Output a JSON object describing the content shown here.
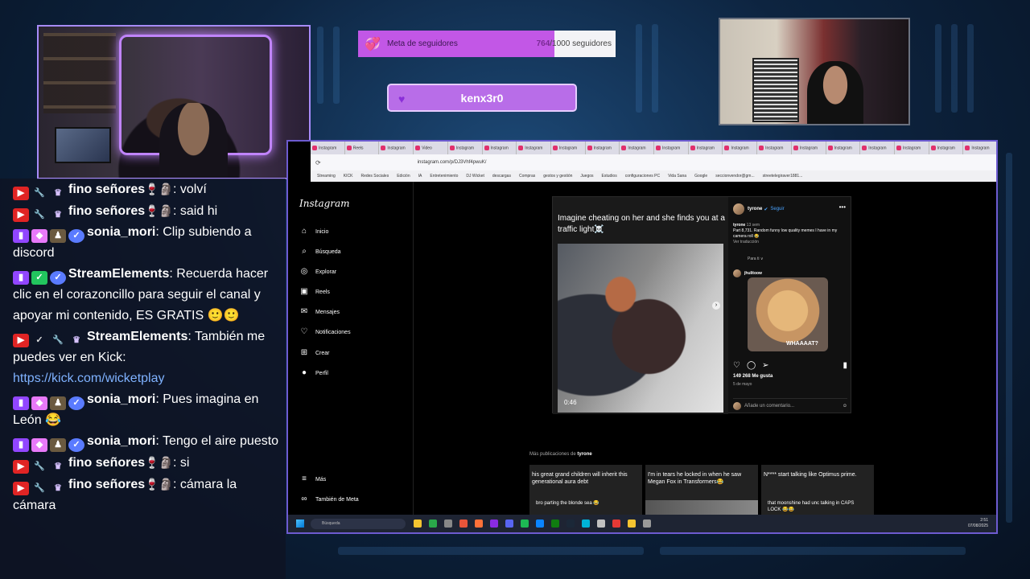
{
  "goal": {
    "label": "Meta de seguidores",
    "current": "764",
    "target": "/1000 seguidores",
    "progress_fraction": 0.764,
    "icon": "hearts-icon"
  },
  "follower_alert": {
    "name": "kenx3r0",
    "icon": "heart-icon"
  },
  "colors": {
    "goal_fill": "#c257e6",
    "alert_bg": "#b86de8",
    "frame": "#6d5bd0",
    "link": "#7fb2ff"
  },
  "chat": [
    {
      "platform": "youtube",
      "user": "fino señores",
      "text": ": volví",
      "badges": [
        "mod",
        "crown"
      ]
    },
    {
      "platform": "youtube",
      "user": "fino señores",
      "text": ": said hi",
      "badges": [
        "mod",
        "crown"
      ]
    },
    {
      "platform": "twitch",
      "user": "sonia_mori",
      "text": ": Clip subiendo a discord",
      "badges": [
        "gem",
        "fig",
        "verified"
      ]
    },
    {
      "platform": "twitch",
      "user": "StreamElements",
      "text": ": Recuerda hacer clic en el corazoncillo para seguir el canal y apoyar mi contenido, ES GRATIS 🙂🙂",
      "badges": [
        "green-check",
        "verified"
      ]
    },
    {
      "platform": "youtube",
      "user": "StreamElements",
      "text": ": También me puedes ver en Kick:",
      "link": "https://kick.com/wicketplay",
      "badges": [
        "check",
        "mod",
        "crown"
      ]
    },
    {
      "platform": "twitch",
      "user": "sonia_mori",
      "text": ": Pues imagina en León 😂",
      "badges": [
        "gem",
        "fig",
        "verified"
      ]
    },
    {
      "platform": "twitch",
      "user": "sonia_mori",
      "text": ": Tengo el aire puesto",
      "badges": [
        "gem",
        "fig",
        "verified"
      ]
    },
    {
      "platform": "youtube",
      "user": "fino señores",
      "text": ": si",
      "badges": [
        "mod",
        "crown"
      ]
    },
    {
      "platform": "youtube",
      "user": "fino señores",
      "text": ": cámara la cámara",
      "badges": [
        "mod",
        "crown"
      ]
    }
  ],
  "browser": {
    "url": "instagram.com/p/DJ3Vhf4pwuK/",
    "tabs": [
      "Instagram",
      "Reels",
      "Instagram",
      "Video",
      "Instagram",
      "Instagram",
      "Instagram",
      "Instagram",
      "Instagram",
      "Instagram",
      "Instagram",
      "Instagram",
      "Instagram",
      "Instagram",
      "Instagram",
      "Instagram",
      "Instagram",
      "Instagram",
      "Instagram",
      "Instagram"
    ],
    "bookmarks": [
      "Streaming",
      "KICK",
      "Redes Sociales",
      "Edición",
      "IA",
      "Entretenimiento",
      "DJ Wicket",
      "descargas",
      "Compras",
      "gestos y gestión",
      "Juegos",
      "Estudios",
      "configuraciones PC",
      "Vida Sana",
      "Google",
      "seccionvendor@gm...",
      "streetelegiraver1881..."
    ]
  },
  "instagram": {
    "logo": "Instagram",
    "nav": [
      {
        "label": "Inicio",
        "icon": "home-icon"
      },
      {
        "label": "Búsqueda",
        "icon": "search-icon"
      },
      {
        "label": "Explorar",
        "icon": "compass-icon"
      },
      {
        "label": "Reels",
        "icon": "reels-icon"
      },
      {
        "label": "Mensajes",
        "icon": "messenger-icon",
        "badge": "1"
      },
      {
        "label": "Notificaciones",
        "icon": "heart-icon"
      },
      {
        "label": "Crear",
        "icon": "plus-square-icon"
      },
      {
        "label": "Perfil",
        "icon": "avatar-icon"
      }
    ],
    "bottom_nav": [
      {
        "label": "Más",
        "icon": "menu-icon"
      },
      {
        "label": "También de Meta",
        "icon": "meta-icon"
      }
    ],
    "post": {
      "caption": "Imagine cheating on her and she finds you at a traffic light☠️",
      "video_time": "0:46",
      "author": "tyrone",
      "follow": "Seguir",
      "comment_time": "13 sem",
      "comment_text": "Part 8,731. Random funny low quality memes I have in my camera roll 😂",
      "see_translation": "Ver traducción",
      "for_you": "Para ti ∨",
      "reply_user": "jhulitoow",
      "dog_caption": "WHAAAAT?",
      "likes": "149 268 Me gusta",
      "ago": "5 de mayo",
      "add_comment": "Añade un comentario..."
    },
    "more_from": "Más publicaciones de",
    "more_user": "tyrone",
    "thumbs": [
      {
        "top": "his great grand children will inherit this generational aura debt",
        "bottom": "bro parting the blonde sea 😂"
      },
      {
        "top": "I'm in tears he locked in when he saw Megan Fox in Transformers😂",
        "bottom": ""
      },
      {
        "top": "N**** start talking like Optimus prime.",
        "bottom": "that moonshine had unc talking in CAPS LOCK 😂😂"
      }
    ]
  },
  "taskbar": {
    "search": "Búsqueda",
    "time": "2:51",
    "date": "07/08/2025"
  }
}
